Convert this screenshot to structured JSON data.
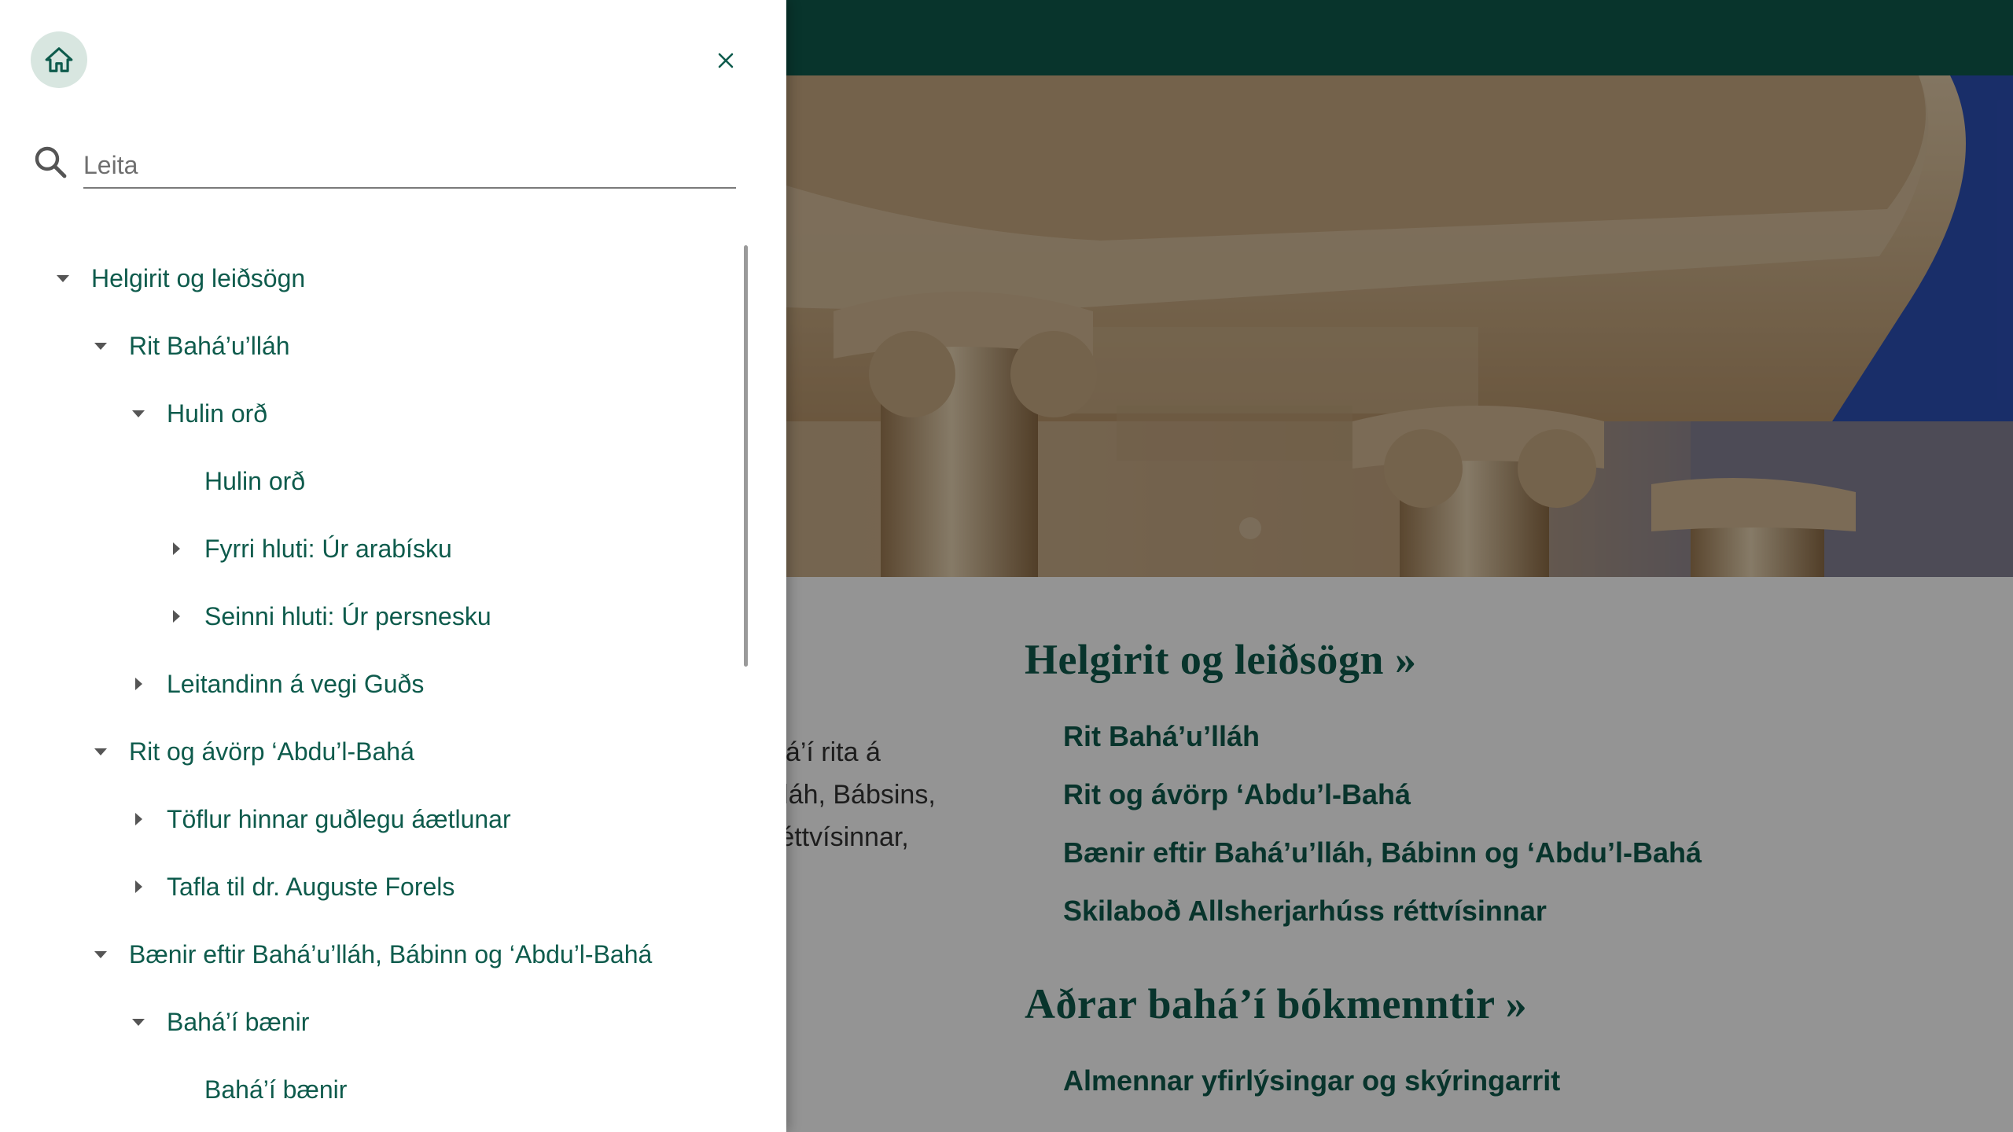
{
  "drawer": {
    "search": {
      "placeholder": "Leita",
      "value": ""
    },
    "tree": [
      {
        "label": "Helgirit og leiðsögn",
        "level": 0,
        "state": "expanded"
      },
      {
        "label": "Rit Bahá’u’lláh",
        "level": 1,
        "state": "expanded"
      },
      {
        "label": "Hulin orð",
        "level": 2,
        "state": "expanded"
      },
      {
        "label": "Hulin orð",
        "level": 3,
        "state": "leaf"
      },
      {
        "label": "Fyrri hluti: Úr arabísku",
        "level": 3,
        "state": "collapsed"
      },
      {
        "label": "Seinni hluti: Úr persnesku",
        "level": 3,
        "state": "collapsed"
      },
      {
        "label": "Leitandinn á vegi Guðs",
        "level": 2,
        "state": "collapsed"
      },
      {
        "label": "Rit og ávörp ‘Abdu’l-Bahá",
        "level": 1,
        "state": "expanded"
      },
      {
        "label": "Töflur hinnar guðlegu áætlunar",
        "level": 2,
        "state": "collapsed"
      },
      {
        "label": "Tafla til dr. Auguste Forels",
        "level": 2,
        "state": "collapsed"
      },
      {
        "label": "Bænir eftir Bahá’u’lláh, Bábinn og ‘Abdu’l-Bahá",
        "level": 1,
        "state": "expanded"
      },
      {
        "label": "Bahá’í bænir",
        "level": 2,
        "state": "expanded"
      },
      {
        "label": "Bahá’í bænir",
        "level": 3,
        "state": "leaf"
      }
    ]
  },
  "main": {
    "intro_lines": [
      "há’í rita á",
      "’lláh, Bábsins,",
      "réttvísinnar,"
    ],
    "sections": [
      {
        "title": "Helgirit og leiðsögn »",
        "links": [
          "Rit Bahá’u’lláh",
          "Rit og ávörp ‘Abdu’l-Bahá",
          "Bænir eftir Bahá’u’lláh, Bábinn og ‘Abdu’l-Bahá",
          "Skilaboð Allsherjarhúss réttvísinnar"
        ]
      },
      {
        "title": "Aðrar bahá’í bókmenntir »",
        "links": [
          "Almennar yfirlýsingar og skýringarrit"
        ]
      }
    ]
  },
  "colors": {
    "brand": "#0e5b4c",
    "home_button_bg": "#d8e6e0",
    "hero_sky": "#2b4fb8"
  },
  "icons": {
    "home": "home-icon",
    "close": "close-icon",
    "search": "search-icon",
    "expanded": "caret-down-icon",
    "collapsed": "caret-right-icon"
  }
}
